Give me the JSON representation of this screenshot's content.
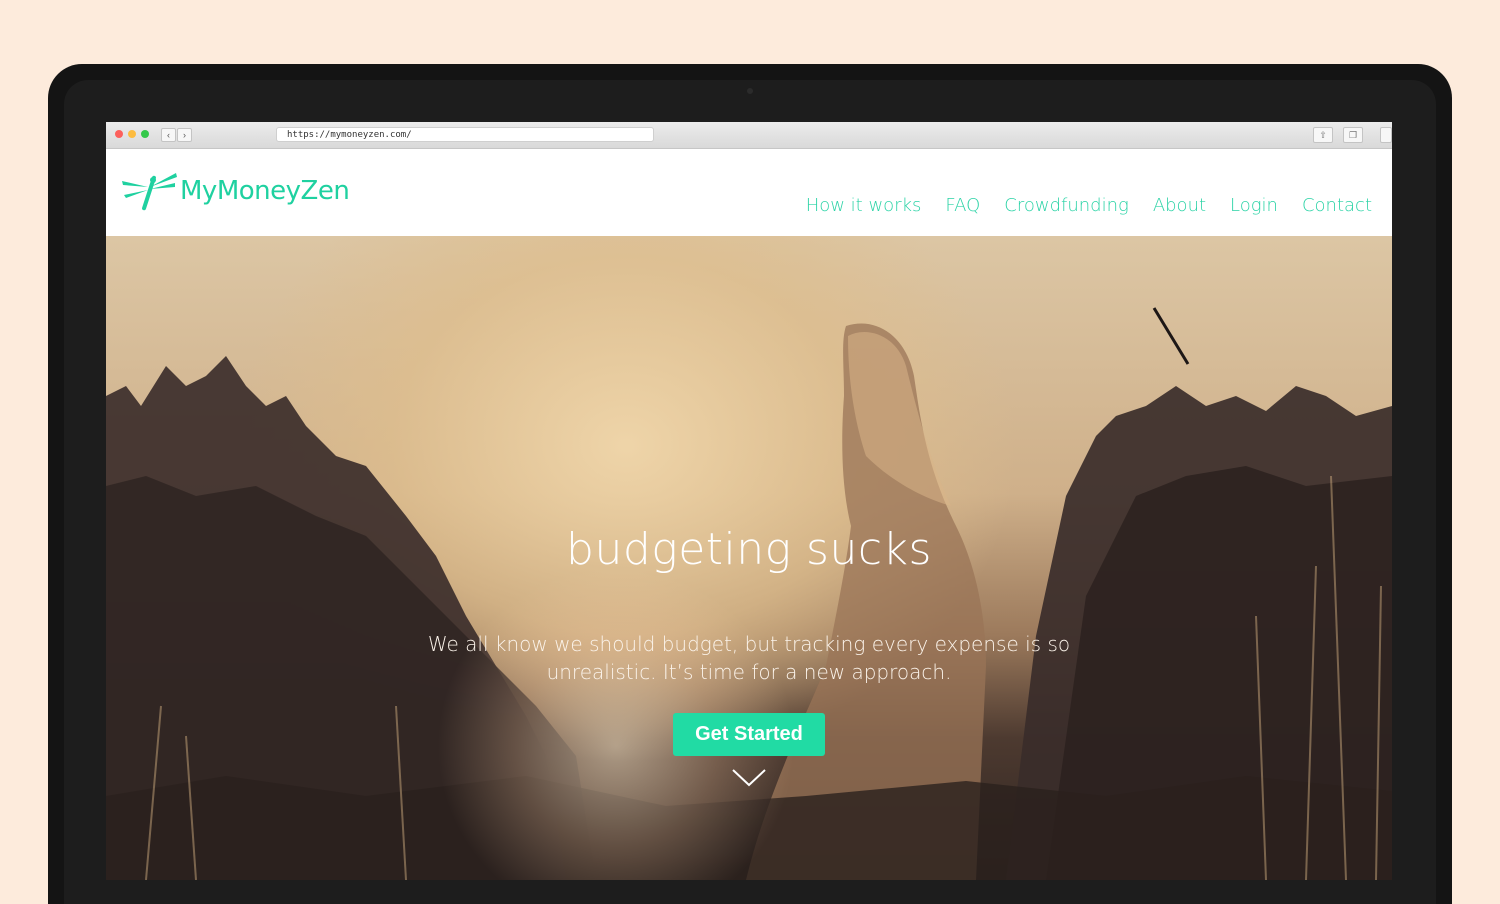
{
  "browser": {
    "url": "https://mymoneyzen.com/",
    "back_glyph": "‹",
    "forward_glyph": "›"
  },
  "site": {
    "logo_text": "MyMoneyZen",
    "brand_color": "#1fd1a0",
    "nav": [
      {
        "label": "How it works"
      },
      {
        "label": "FAQ"
      },
      {
        "label": "Crowdfunding"
      },
      {
        "label": "About"
      },
      {
        "label": "Login"
      },
      {
        "label": "Contact"
      }
    ]
  },
  "hero": {
    "title": "budgeting sucks",
    "text": "We all know we should budget, but tracking every expense is so unrealistic. It’s time for a new approach.",
    "cta_label": "Get Started",
    "cta_color": "#21dba4"
  },
  "icons": {
    "logo": "dragonfly-icon",
    "scroll": "chevron-down-icon"
  }
}
